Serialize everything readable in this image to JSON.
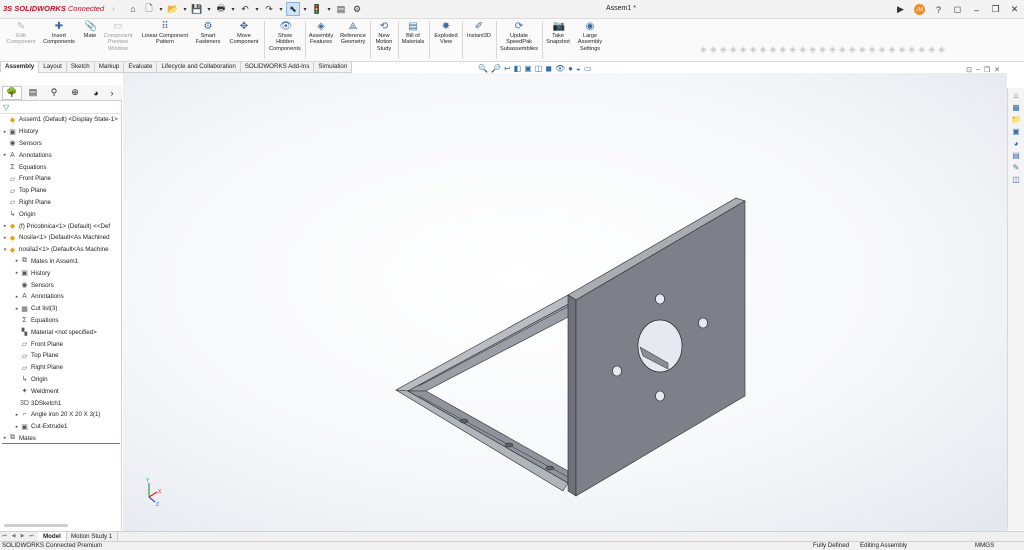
{
  "app": {
    "brand_ds": "3S",
    "brand_sw": "SOLIDWORKS",
    "brand_suffix": "Connected",
    "document_title": "Assem1 *",
    "user_initials": "JM"
  },
  "quick_access": [
    {
      "name": "home-icon",
      "glyph": "⌂"
    },
    {
      "name": "new-document-icon",
      "glyph": "🗋"
    },
    {
      "name": "open-icon",
      "glyph": "📂"
    },
    {
      "name": "save-icon",
      "glyph": "💾"
    },
    {
      "name": "print-icon",
      "glyph": "🖶"
    },
    {
      "name": "undo-icon",
      "glyph": "↶"
    },
    {
      "name": "redo-icon",
      "glyph": "↷"
    },
    {
      "name": "select-icon",
      "glyph": "⬉"
    },
    {
      "name": "rebuild-icon",
      "glyph": "🚦"
    },
    {
      "name": "file-properties-icon",
      "glyph": "▤"
    },
    {
      "name": "options-icon",
      "glyph": "⚙"
    }
  ],
  "ribbon": {
    "edit_component": "Edit\nComponent",
    "insert_components": "Insert\nComponents",
    "mate": "Mate",
    "component_preview": "Component\nPreview\nWindow",
    "linear_pattern": "Linear Component\nPattern",
    "smart_fasteners": "Smart\nFasteners",
    "move_component": "Move\nComponent",
    "show_hidden": "Show\nHidden\nComponents",
    "assembly_features": "Assembly\nFeatures",
    "reference_geometry": "Reference\nGeometry",
    "new_motion_study": "New\nMotion\nStudy",
    "bill_of_materials": "Bill of\nMaterials",
    "exploded_view": "Exploded\nView",
    "instant3d": "Instant3D",
    "update_speedpak": "Update\nSpeedPak\nSubassemblies",
    "take_snapshot": "Take\nSnapshot",
    "large_assembly": "Large\nAssembly\nSettings"
  },
  "command_tabs": [
    "Assembly",
    "Layout",
    "Sketch",
    "Markup",
    "Evaluate",
    "Lifecycle and Collaboration",
    "SOLIDWORKS Add-Ins",
    "Simulation"
  ],
  "feature_tree": [
    {
      "label": "Assem1 (Default) <Display State-1>",
      "icon": "assembly-icon",
      "glyph": "◆",
      "exp": ""
    },
    {
      "label": "History",
      "icon": "history-icon",
      "glyph": "▣",
      "exp": "▸"
    },
    {
      "label": "Sensors",
      "icon": "sensors-icon",
      "glyph": "◉",
      "exp": ""
    },
    {
      "label": "Annotations",
      "icon": "annotations-icon",
      "glyph": "A",
      "exp": "▸"
    },
    {
      "label": "Equations",
      "icon": "equations-icon",
      "glyph": "Σ",
      "exp": ""
    },
    {
      "label": "Front Plane",
      "icon": "plane-icon",
      "glyph": "▱",
      "exp": ""
    },
    {
      "label": "Top Plane",
      "icon": "plane-icon",
      "glyph": "▱",
      "exp": ""
    },
    {
      "label": "Right Plane",
      "icon": "plane-icon",
      "glyph": "▱",
      "exp": ""
    },
    {
      "label": "Origin",
      "icon": "origin-icon",
      "glyph": "↳",
      "exp": ""
    },
    {
      "label": "(f) Pricobnica<1> (Default) <<Def",
      "icon": "part-icon",
      "glyph": "◆",
      "exp": "▸"
    },
    {
      "label": "Nosila<1> (Default<As Machined",
      "icon": "part-icon",
      "glyph": "◆",
      "exp": "▸"
    },
    {
      "label": "nosila2<1> (Default<As Machine",
      "icon": "part-icon",
      "glyph": "◆",
      "exp": "▾"
    },
    {
      "label": "Mates in Assem1",
      "icon": "mates-icon",
      "glyph": "⧉",
      "exp": "▸",
      "indent": 1
    },
    {
      "label": "History",
      "icon": "history-icon",
      "glyph": "▣",
      "exp": "▸",
      "indent": 1
    },
    {
      "label": "Sensors",
      "icon": "sensors-icon",
      "glyph": "◉",
      "exp": "",
      "indent": 1
    },
    {
      "label": "Annotations",
      "icon": "annotations-icon",
      "glyph": "A",
      "exp": "▸",
      "indent": 1
    },
    {
      "label": "Cut list(3)",
      "icon": "cutlist-icon",
      "glyph": "▦",
      "exp": "▸",
      "indent": 1
    },
    {
      "label": "Equations",
      "icon": "equations-icon",
      "glyph": "Σ",
      "exp": "",
      "indent": 1
    },
    {
      "label": "Material <not specified>",
      "icon": "material-icon",
      "glyph": "▚",
      "exp": "",
      "indent": 1
    },
    {
      "label": "Front Plane",
      "icon": "plane-icon",
      "glyph": "▱",
      "exp": "",
      "indent": 1
    },
    {
      "label": "Top Plane",
      "icon": "plane-icon",
      "glyph": "▱",
      "exp": "",
      "indent": 1
    },
    {
      "label": "Right Plane",
      "icon": "plane-icon",
      "glyph": "▱",
      "exp": "",
      "indent": 1
    },
    {
      "label": "Origin",
      "icon": "origin-icon",
      "glyph": "↳",
      "exp": "",
      "indent": 1
    },
    {
      "label": "Weldment",
      "icon": "weldment-icon",
      "glyph": "✦",
      "exp": "",
      "indent": 1
    },
    {
      "label": "3DSketch1",
      "icon": "sketch3d-icon",
      "glyph": "3D",
      "exp": "",
      "indent": 1
    },
    {
      "label": "Angle iron 20 X 20 X 3(1)",
      "icon": "structural-member-icon",
      "glyph": "⌐",
      "exp": "▸",
      "indent": 1
    },
    {
      "label": "Cut-Extrude1",
      "icon": "cut-extrude-icon",
      "glyph": "▣",
      "exp": "▸",
      "indent": 1
    },
    {
      "label": "Mates",
      "icon": "mates-icon",
      "glyph": "⧉",
      "exp": "▸"
    }
  ],
  "bottom_tabs": {
    "model": "Model",
    "motion_study": "Motion Study 1"
  },
  "status_bar": {
    "product": "SOLIDWORKS Connected Premium",
    "state": "Fully Defined",
    "mode": "Editing Assembly",
    "units": "MMGS"
  },
  "triad": {
    "x": "X",
    "y": "Y",
    "z": "Z"
  },
  "colors": {
    "brand_red": "#c8102e",
    "accent_blue": "#3a6ea5",
    "part_face": "#7d8089",
    "part_edge": "#2a2a2a"
  }
}
